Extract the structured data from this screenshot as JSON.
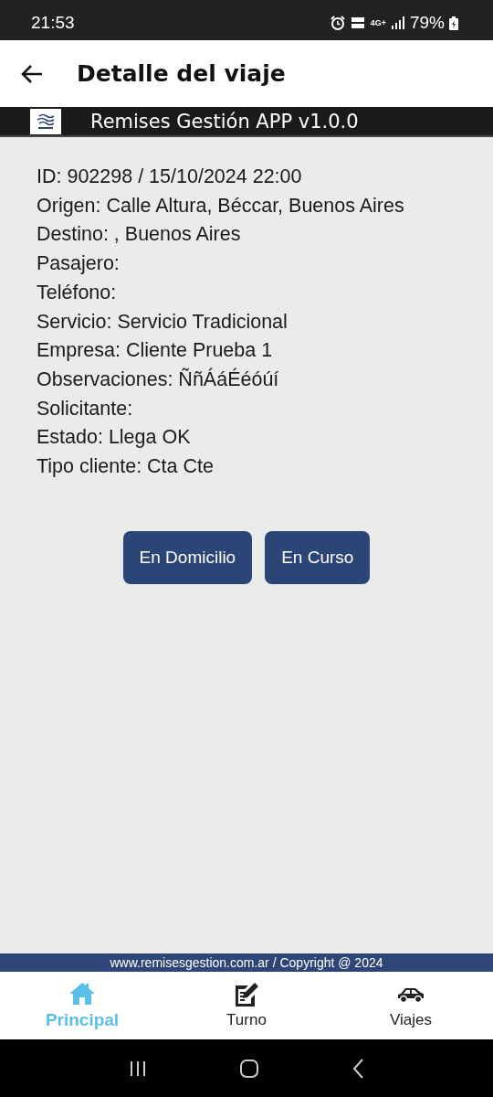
{
  "status_bar": {
    "time": "21:53",
    "network": "4G+",
    "battery": "79%"
  },
  "app_bar": {
    "title": "Detalle del viaje"
  },
  "brand_bar": {
    "title": "Remises Gestión APP v1.0.0"
  },
  "details": [
    "ID: 902298 / 15/10/2024 22:00",
    "Origen: Calle Altura, Béccar, Buenos Aires",
    "Destino: , Buenos Aires",
    "Pasajero:",
    "Teléfono:",
    "Servicio: Servicio Tradicional",
    "Empresa: Cliente Prueba 1",
    "Observaciones: ÑñÁáÉéóúí",
    "Solicitante:",
    "Estado: Llega OK",
    "Tipo cliente: Cta Cte"
  ],
  "buttons": [
    "En Domicilio",
    "En Curso"
  ],
  "footer": "www.remisesgestion.com.ar / Copyright @ 2024",
  "bottom_nav": [
    {
      "label": "Principal",
      "kind": "home",
      "selected": true
    },
    {
      "label": "Turno",
      "kind": "form",
      "selected": false
    },
    {
      "label": "Viajes",
      "kind": "car",
      "selected": false
    }
  ]
}
